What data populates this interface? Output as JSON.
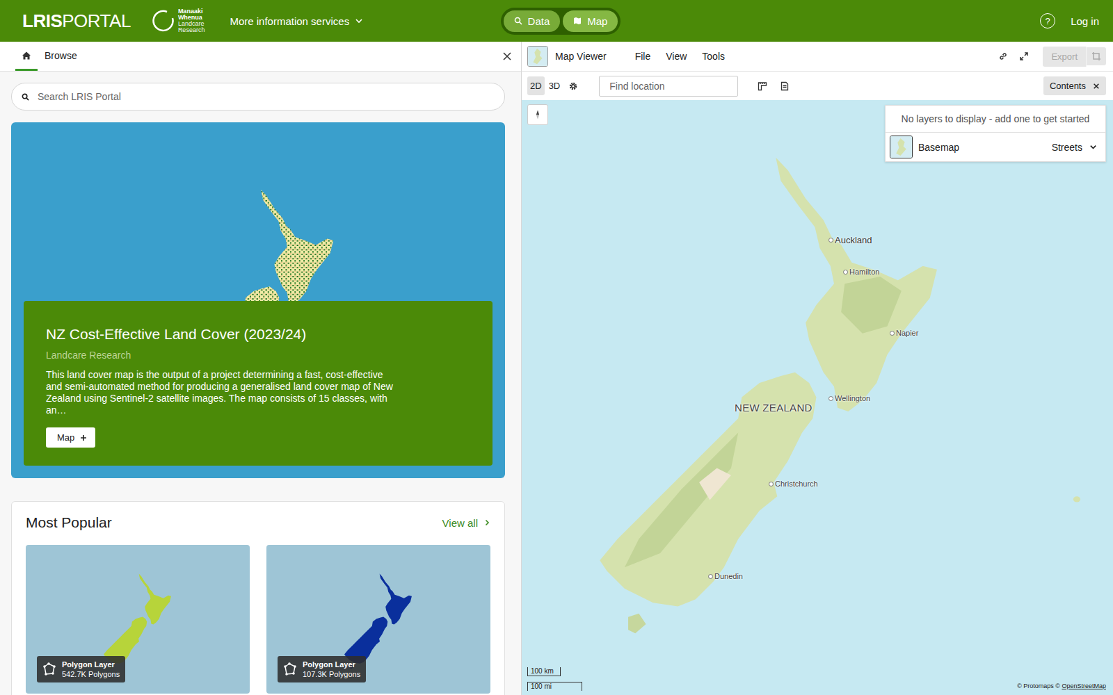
{
  "header": {
    "logo_bold": "LRIS",
    "logo_light": "PORTAL",
    "partner_logo": [
      "Manaaki",
      "Whenua",
      "Landcare",
      "Research"
    ],
    "menu": "More information services",
    "modes": [
      {
        "label": "Data",
        "selected": false
      },
      {
        "label": "Map",
        "selected": true
      }
    ],
    "help": "?",
    "login": "Log in"
  },
  "left_panel": {
    "home_tab": {
      "selected": true
    },
    "tabs": [
      {
        "label": "Browse",
        "selected": false
      }
    ],
    "search": {
      "placeholder": "Search LRIS Portal"
    },
    "featured": {
      "title": "NZ Cost-Effective Land Cover (2023/24)",
      "organisation": "Landcare Research",
      "description": "This land cover map is the output of a project determining a fast, cost-effective and semi-automated method for producing a generalised land cover map of New Zealand using Sentinel-2 satellite images. The map consists of 15 classes, with an…",
      "button": "Map"
    },
    "popular": {
      "title": "Most Popular",
      "link": "View all",
      "items": [
        {
          "type": "Polygon Layer",
          "count": "542.7K Polygons",
          "color": "#b7d43a"
        },
        {
          "type": "Polygon Layer",
          "count": "107.3K Polygons",
          "color": "#0a2f9c"
        }
      ]
    }
  },
  "map_viewer": {
    "title": "Map Viewer",
    "menus": [
      "File",
      "View",
      "Tools"
    ],
    "export": {
      "label": "Export",
      "disabled": true
    },
    "view_modes": [
      {
        "label": "2D",
        "selected": true
      },
      {
        "label": "3D",
        "selected": false
      }
    ],
    "find": {
      "placeholder": "Find location"
    },
    "contents_button": "Contents",
    "contents": {
      "message": "No layers to display - add one to get started",
      "basemap": {
        "label": "Basemap",
        "value": "Streets"
      }
    },
    "country": "NEW ZEALAND",
    "cities": [
      "Auckland",
      "Hamilton",
      "Napier",
      "Wellington",
      "Christchurch",
      "Dunedin"
    ],
    "scale": [
      "100 km",
      "100 mi"
    ],
    "attribution": {
      "prefix": "© Protomaps ©",
      "link": "OpenStreetMap"
    }
  }
}
